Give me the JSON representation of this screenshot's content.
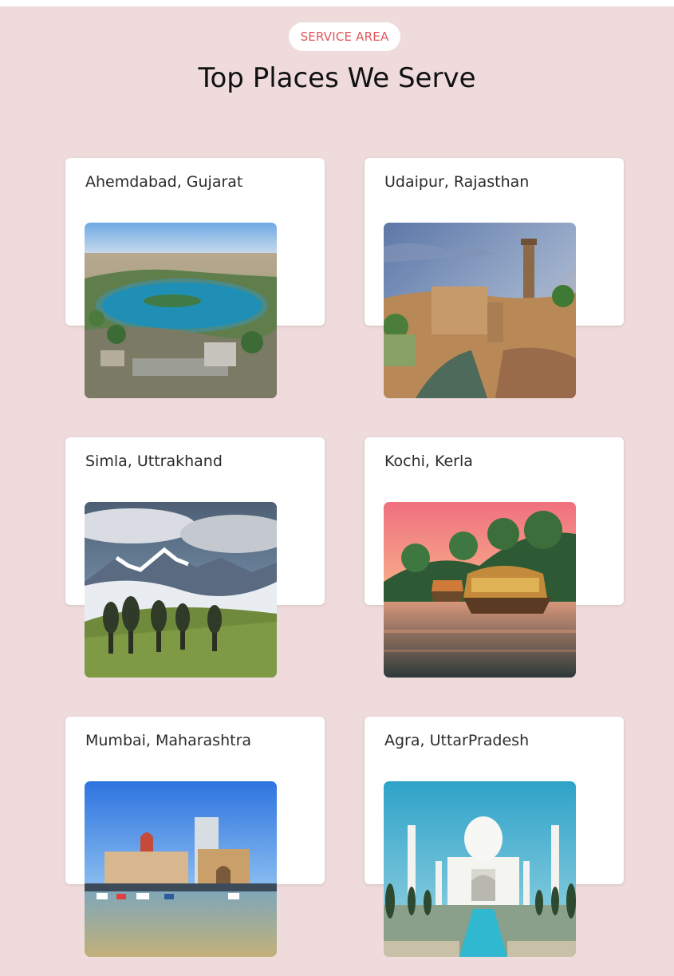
{
  "section": {
    "tag": "SERVICE AREA",
    "title": "Top Places We Serve",
    "background": "#efdbdb",
    "tag_color": "#e0575b"
  },
  "places": [
    {
      "label": "Ahemdabad, Gujarat",
      "image": "lake-city-aerial"
    },
    {
      "label": "Udaipur, Rajasthan",
      "image": "fort-tower-lake"
    },
    {
      "label": "Simla, Uttrakhand",
      "image": "snow-mountains-forest"
    },
    {
      "label": "Kochi, Kerla",
      "image": "houseboat-backwaters"
    },
    {
      "label": "Mumbai, Maharashtra",
      "image": "gateway-of-india-harbor"
    },
    {
      "label": "Agra, UttarPradesh",
      "image": "taj-mahal"
    }
  ]
}
